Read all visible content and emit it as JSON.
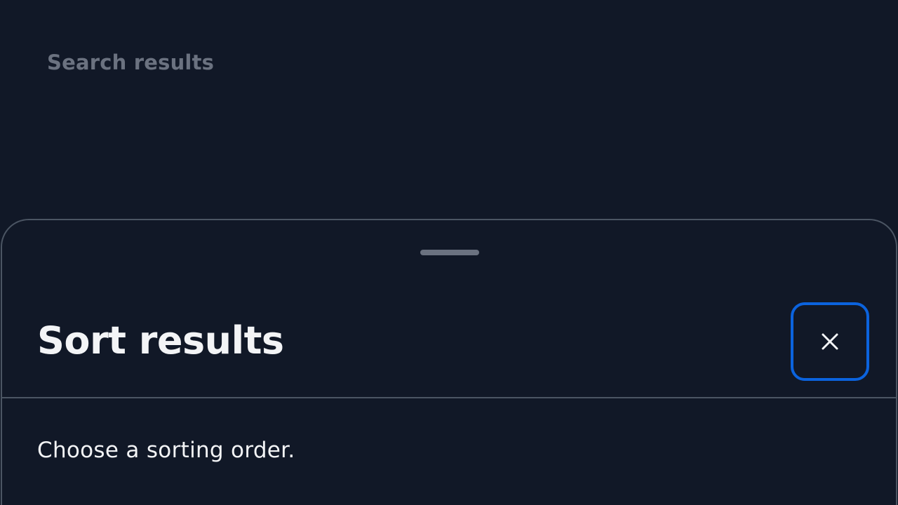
{
  "page": {
    "heading": "Search results"
  },
  "sort_sheet": {
    "title": "Sort results",
    "description": "Choose a sorting order.",
    "close_icon": "close-icon"
  },
  "colors": {
    "background": "#111827",
    "accent_focus": "#0b63de",
    "muted_text": "#6b7280",
    "primary_text": "#f3f4f6",
    "border": "#4b5563"
  }
}
